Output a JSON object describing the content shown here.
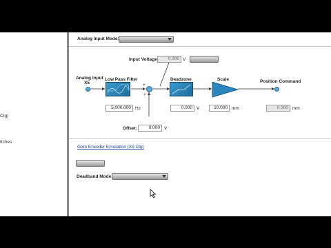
{
  "left_panel": {
    "text_1": "Ctg)",
    "text_2": "ttches"
  },
  "analog_input_mode": {
    "label": "Analog Input Mode:",
    "selected": ""
  },
  "input_voltage": {
    "label": "Input Voltage:",
    "value": "0.000",
    "unit": "V",
    "button_label": ""
  },
  "diagram": {
    "analog_input_label": "Analog Input",
    "analog_input_sub": "X5",
    "low_pass_filter_label": "Low Pass Filter",
    "deadzone_label": "Deadzone",
    "scale_label": "Scale",
    "position_command_label": "Position Command",
    "filter_value": "5,000.000",
    "filter_unit": "Hz",
    "deadzone_value": "0.000",
    "deadzone_unit": "V",
    "scale_value": "10.000",
    "scale_unit": "mm",
    "position_value": "0.000",
    "position_unit": "mm",
    "plus_sign": "+",
    "minus_sign": "+",
    "offset_label": "Offset:",
    "offset_value": "0.000",
    "offset_unit": "V"
  },
  "goto_link": "Goto Encoder Emulation (X9 Ctg)",
  "action_button_label": "",
  "deadband_mode": {
    "label": "Deadband Mode:",
    "selected": ""
  },
  "colors": {
    "block_blue": "#2b86bf",
    "node_blue": "#5aa9d8",
    "link_blue": "#1f3fa0"
  },
  "icons": [
    "mouse-cursor-icon",
    "dropdown-arrow-icon"
  ]
}
